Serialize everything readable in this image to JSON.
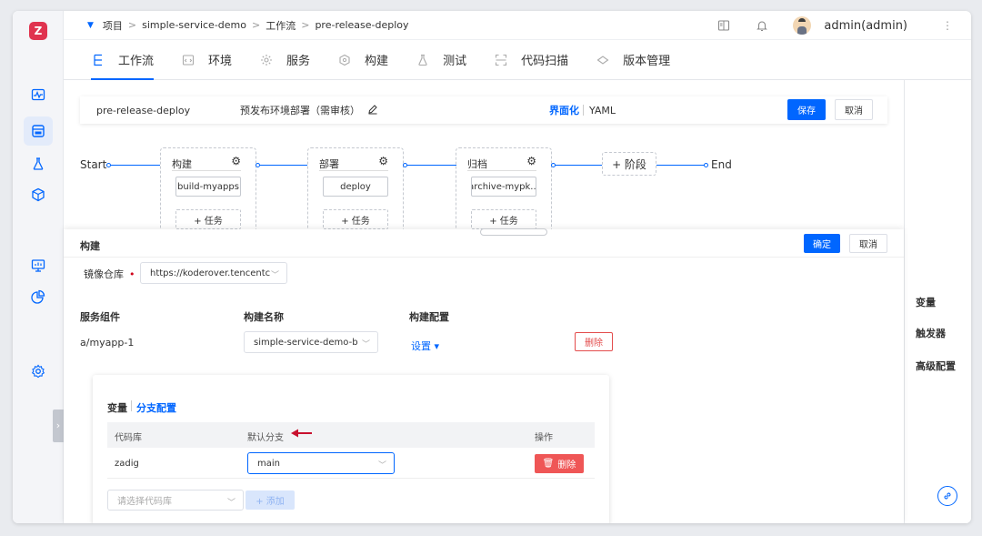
{
  "breadcrumb": {
    "items": [
      "项目",
      "simple-service-demo",
      "工作流",
      "pre-release-deploy"
    ],
    "separator": ">"
  },
  "user": {
    "name": "admin(admin)"
  },
  "nav_tabs": [
    {
      "label": "工作流",
      "icon": "workflow-icon",
      "active": true
    },
    {
      "label": "环境",
      "icon": "environment-icon",
      "active": false
    },
    {
      "label": "服务",
      "icon": "service-icon",
      "active": false
    },
    {
      "label": "构建",
      "icon": "build-icon",
      "active": false
    },
    {
      "label": "测试",
      "icon": "test-icon",
      "active": false
    },
    {
      "label": "代码扫描",
      "icon": "code-scan-icon",
      "active": false
    },
    {
      "label": "版本管理",
      "icon": "version-icon",
      "active": false
    }
  ],
  "workflow": {
    "name": "pre-release-deploy",
    "display_name": "预发布环境部署（需审核）",
    "mode_ui": "界面化",
    "mode_yaml": "YAML",
    "save_label": "保存",
    "cancel_label": "取消"
  },
  "pipeline": {
    "start_label": "Start",
    "end_label": "End",
    "add_stage_label": "+ 阶段",
    "stages": [
      {
        "name": "构建",
        "job": "build-myapps",
        "add_task": "+ 任务"
      },
      {
        "name": "部署",
        "job": "deploy",
        "add_task": "+ 任务"
      },
      {
        "name": "归档",
        "job": "archive-mypk...",
        "add_task": "+ 任务"
      }
    ]
  },
  "build_panel": {
    "title": "构建",
    "confirm_label": "确定",
    "cancel_label": "取消",
    "registry_label": "镜像仓库",
    "registry_value": "https://koderover.tencentc",
    "columns": [
      "服务组件",
      "构建名称",
      "构建配置"
    ],
    "service_component": "a/myapp-1",
    "build_name": "simple-service-demo-b",
    "config_link": "设置 ▾",
    "delete_label": "删除",
    "branch_card": {
      "tab_vars": "变量",
      "tab_branch": "分支配置",
      "headers": [
        "代码库",
        "默认分支",
        "操作"
      ],
      "rows": [
        {
          "repo": "zadig",
          "branch": "main",
          "delete": "删除"
        }
      ],
      "repo_placeholder": "请选择代码库",
      "add_label": "+ 添加"
    }
  },
  "right_panel": {
    "items": [
      "变量",
      "触发器",
      "高级配置"
    ]
  },
  "colors": {
    "accent": "#0066ff",
    "danger": "#ef5656",
    "brand": "#e0334f"
  }
}
